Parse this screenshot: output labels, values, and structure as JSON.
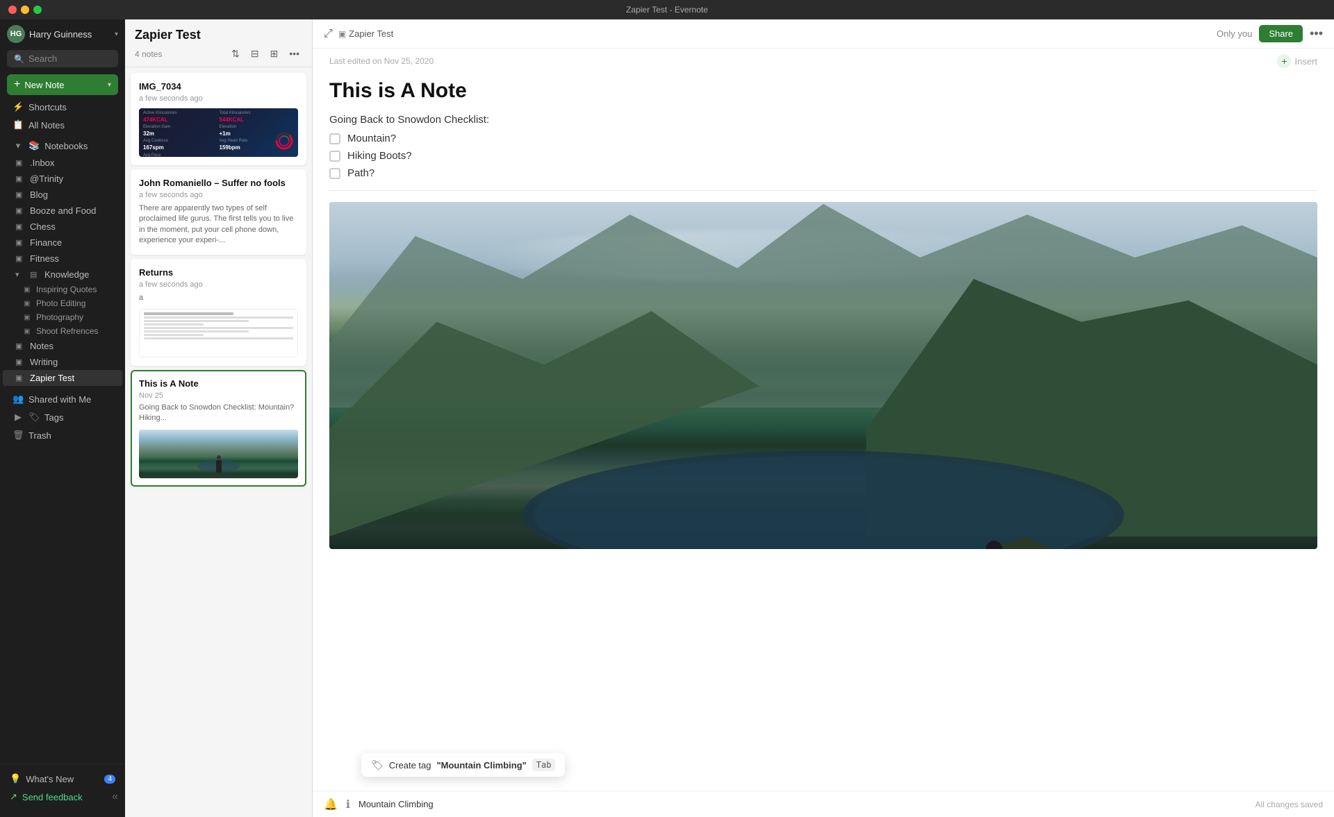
{
  "titlebar": {
    "title": "Zapier Test - Evernote"
  },
  "sidebar": {
    "user_name": "Harry Guinness",
    "search_placeholder": "Search",
    "new_note_label": "New Note",
    "nav_items": [
      {
        "id": "shortcuts",
        "label": "Shortcuts",
        "icon": "⚡"
      },
      {
        "id": "all-notes",
        "label": "All Notes",
        "icon": "📄"
      }
    ],
    "notebooks_label": "Notebooks",
    "notebooks": [
      {
        "id": "inbox",
        "label": ".Inbox",
        "indent": 1
      },
      {
        "id": "trinity",
        "label": "@Trinity",
        "indent": 1
      },
      {
        "id": "blog",
        "label": "Blog",
        "indent": 1
      },
      {
        "id": "booze-food",
        "label": "Booze and Food",
        "indent": 1
      },
      {
        "id": "chess",
        "label": "Chess",
        "indent": 1
      },
      {
        "id": "finance",
        "label": "Finance",
        "indent": 1
      },
      {
        "id": "fitness",
        "label": "Fitness",
        "indent": 1
      },
      {
        "id": "knowledge",
        "label": "Knowledge",
        "indent": 1,
        "expanded": true
      },
      {
        "id": "inspiring-quotes",
        "label": "Inspiring Quotes",
        "indent": 2
      },
      {
        "id": "photo-editing",
        "label": "Photo Editing",
        "indent": 2
      },
      {
        "id": "photography",
        "label": "Photography",
        "indent": 2
      },
      {
        "id": "shoot-refrences",
        "label": "Shoot Refrences",
        "indent": 2
      },
      {
        "id": "notes",
        "label": "Notes",
        "indent": 1
      },
      {
        "id": "writing",
        "label": "Writing",
        "indent": 1
      },
      {
        "id": "zapier-test",
        "label": "Zapier Test",
        "indent": 1,
        "active": true
      }
    ],
    "shared_label": "Shared with Me",
    "tags_label": "Tags",
    "trash_label": "Trash",
    "whats_new_label": "What's New",
    "whats_new_count": "4",
    "send_feedback_label": "Send feedback"
  },
  "notes_panel": {
    "title": "Zapier Test",
    "count": "4 notes",
    "cards": [
      {
        "id": "img7034",
        "title": "IMG_7034",
        "time": "a few seconds ago",
        "preview": "",
        "type": "fitness"
      },
      {
        "id": "john-romaniello",
        "title": "John Romaniello – Suffer no fools",
        "time": "a few seconds ago",
        "preview": "There are apparently two types of self proclaimed life gurus. The first tells you to live in the moment, put your cell phone down, experience your experi-...",
        "type": "text"
      },
      {
        "id": "returns",
        "title": "Returns",
        "time": "a few seconds ago",
        "preview": "a",
        "type": "document"
      },
      {
        "id": "this-is-a-note",
        "title": "This is A Note",
        "date": "Nov 25",
        "preview": "Going Back to Snowdon Checklist: Mountain? Hiking...",
        "type": "mountain",
        "selected": true
      }
    ]
  },
  "editor": {
    "breadcrumb": "Zapier Test",
    "only_you": "Only you",
    "share_label": "Share",
    "last_edited": "Last edited on Nov 25, 2020",
    "insert_label": "Insert",
    "note_title": "This is A Note",
    "checklist_label": "Going Back to Snowdon Checklist:",
    "checklist_items": [
      {
        "label": "Mountain?",
        "checked": false
      },
      {
        "label": "Hiking Boots?",
        "checked": false
      },
      {
        "label": "Path?",
        "checked": false
      }
    ],
    "saved_status": "All changes saved"
  },
  "tag_suggestion": {
    "text": "Create tag",
    "tag_name": "\"Mountain Climbing\"",
    "shortcut": "Tab"
  },
  "bottom_bar": {
    "tag_value": "Mountain Climbing"
  }
}
